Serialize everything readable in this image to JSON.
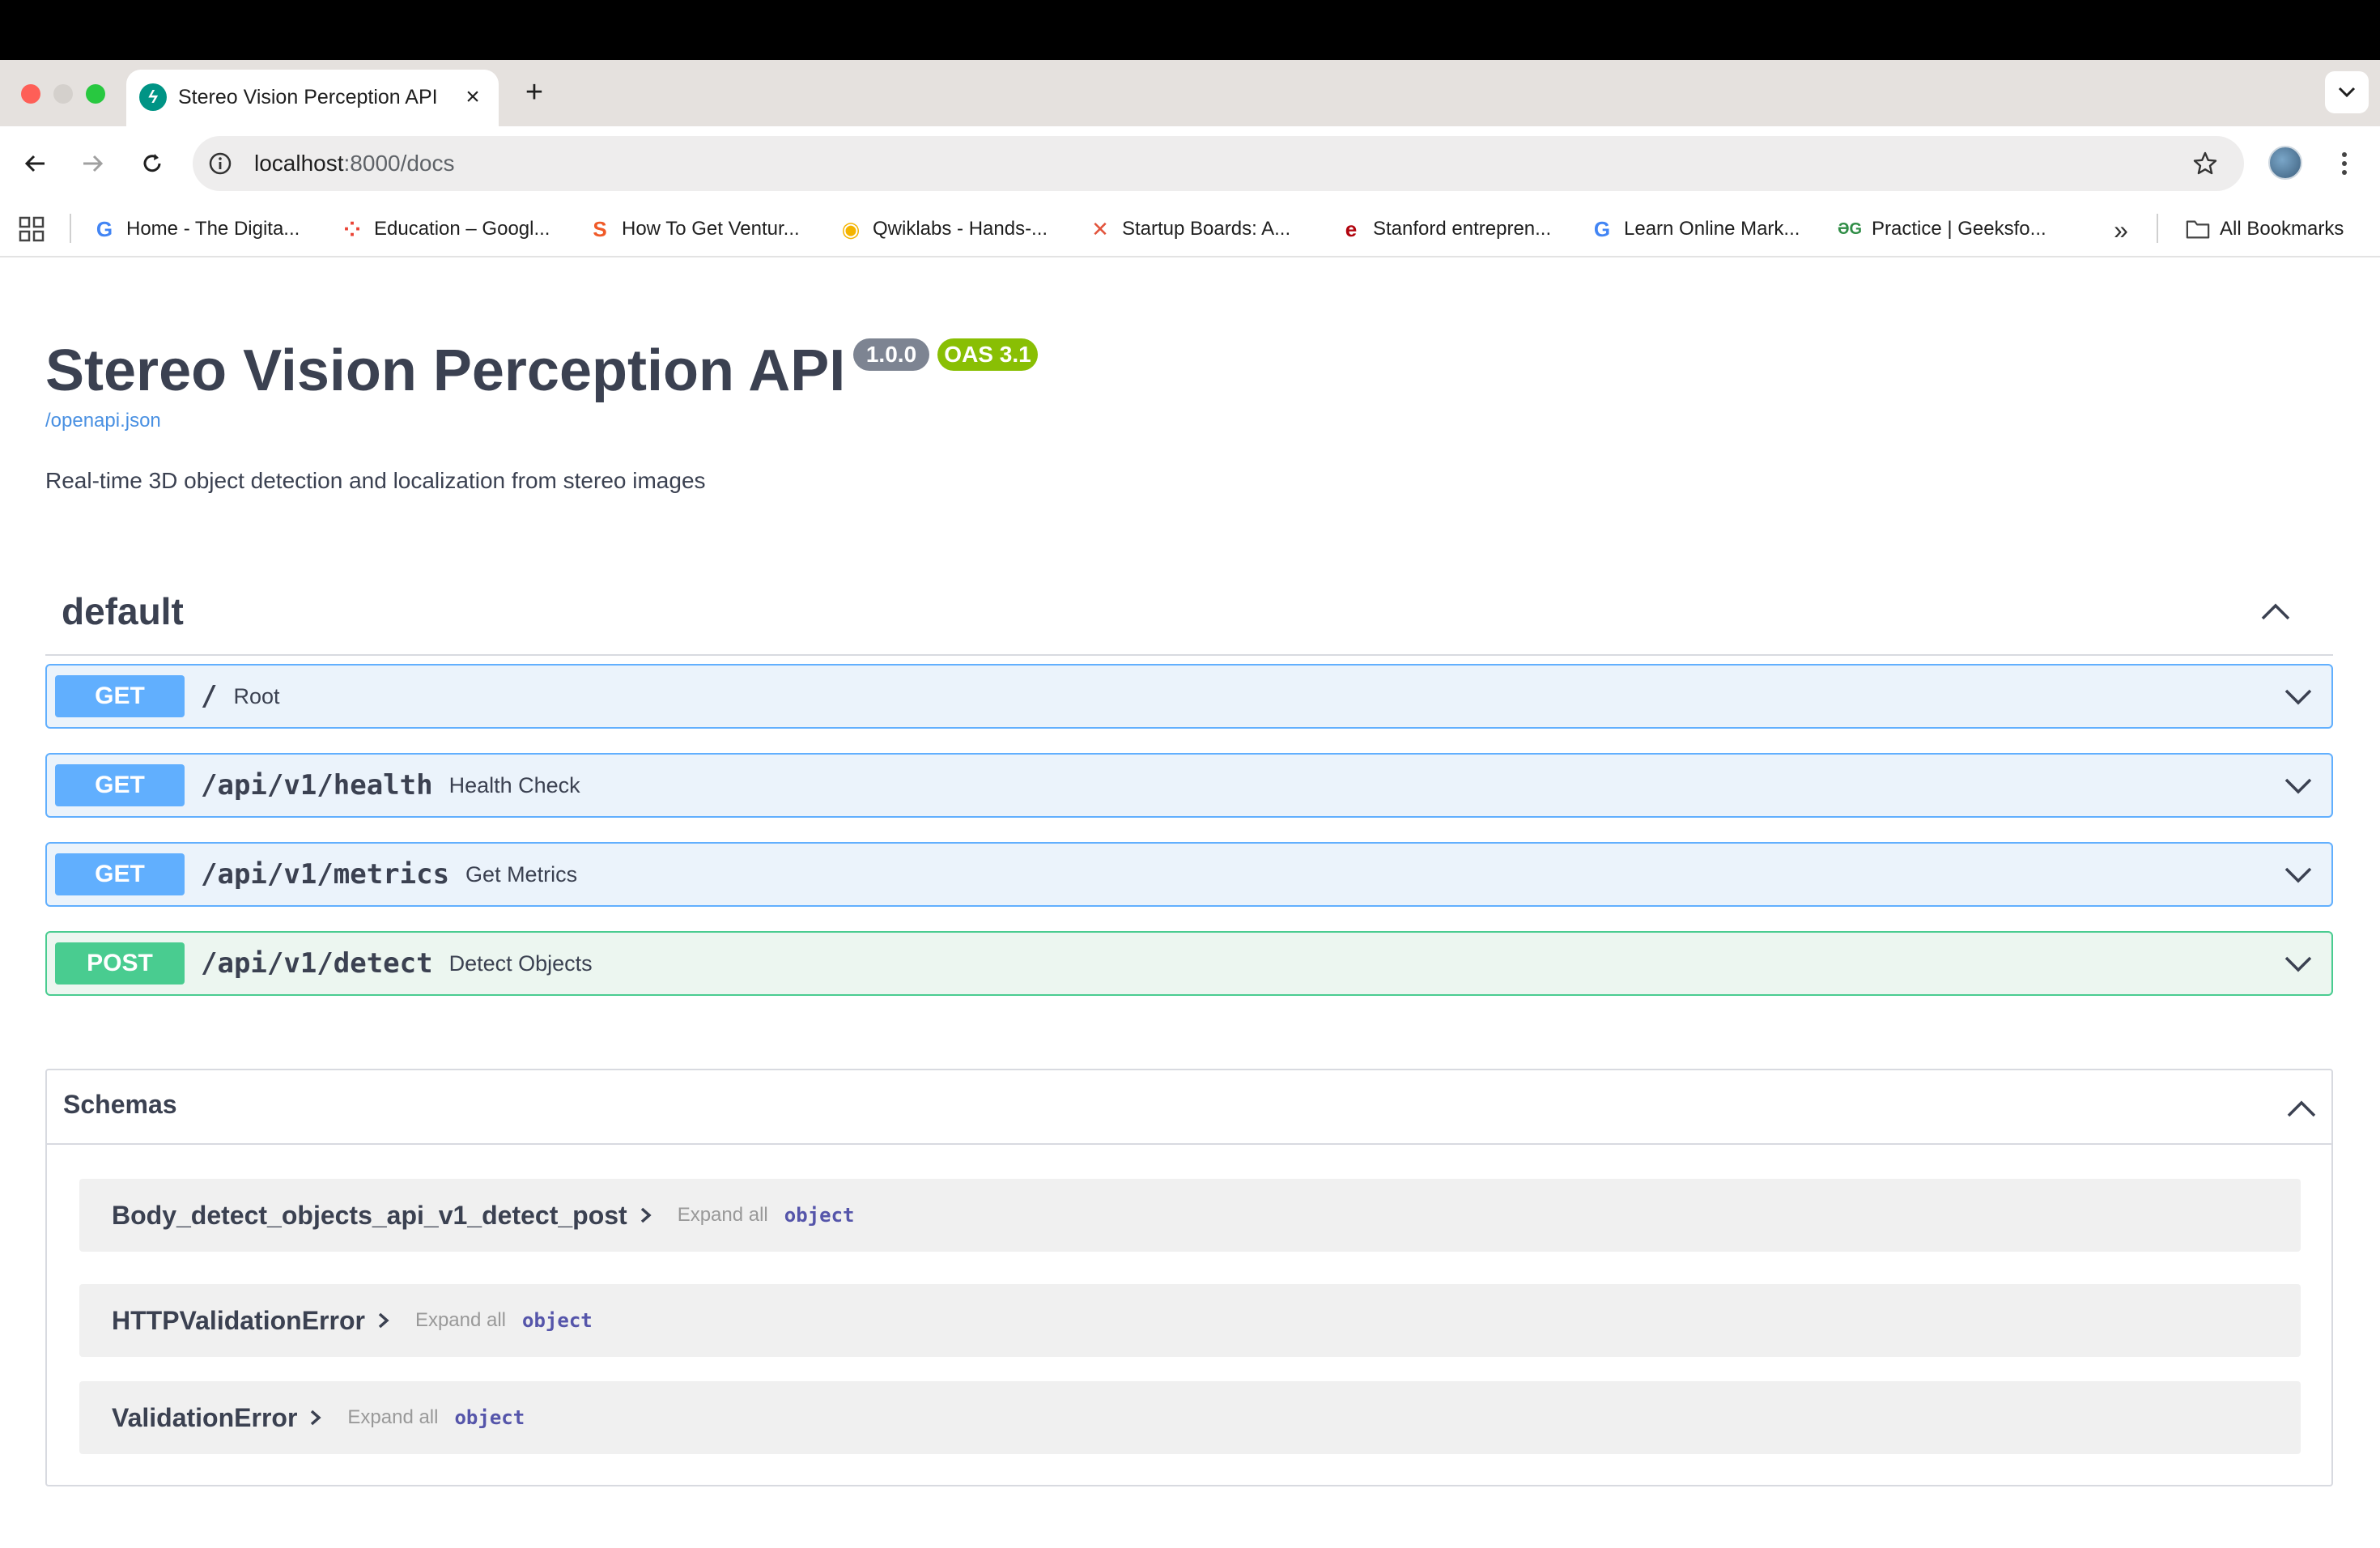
{
  "browser": {
    "tab": {
      "title": "Stereo Vision Perception API",
      "favicon": "fastapi-logo",
      "favicon_glyph": "ϟ"
    },
    "new_tab_label": "+",
    "url_host": "localhost",
    "url_path": ":8000/docs",
    "bookmarks": [
      {
        "label": "Home - The Digita...",
        "icon": "google-g-icon",
        "glyph": "G",
        "color": "#4285f4"
      },
      {
        "label": "Education – Googl...",
        "icon": "google-dots-icon",
        "glyph": "⁘",
        "color": "#ea4335"
      },
      {
        "label": "How To Get Ventur...",
        "icon": "s-logo-icon",
        "glyph": "S",
        "color": "#f05a28"
      },
      {
        "label": "Qwiklabs - Hands-...",
        "icon": "qwiklabs-icon",
        "glyph": "◉",
        "color": "#f4b400"
      },
      {
        "label": "Startup Boards: A...",
        "icon": "startup-boards-icon",
        "glyph": "✕",
        "color": "#e2543c"
      },
      {
        "label": "Stanford entrepren...",
        "icon": "stanford-e-icon",
        "glyph": "e",
        "color": "#b1040e"
      },
      {
        "label": "Learn Online Mark...",
        "icon": "google-g-icon",
        "glyph": "G",
        "color": "#4285f4"
      },
      {
        "label": "Practice | Geeksfo...",
        "icon": "geeksforgeeks-icon",
        "glyph": "ƏG",
        "color": "#2f8d46"
      }
    ],
    "more_bookmarks": "»",
    "all_bookmarks_label": "All Bookmarks"
  },
  "page": {
    "title": "Stereo Vision Perception API",
    "version": "1.0.0",
    "oas": "OAS 3.1",
    "spec_link": "/openapi.json",
    "description": "Real-time 3D object detection and localization from stereo images",
    "section": {
      "name": "default",
      "operations": [
        {
          "method": "GET",
          "path": "/",
          "summary": "Root"
        },
        {
          "method": "GET",
          "path": "/api/v1/health",
          "summary": "Health Check"
        },
        {
          "method": "GET",
          "path": "/api/v1/metrics",
          "summary": "Get Metrics"
        },
        {
          "method": "POST",
          "path": "/api/v1/detect",
          "summary": "Detect Objects"
        }
      ]
    },
    "schemas": {
      "title": "Schemas",
      "models": [
        {
          "name": "Body_detect_objects_api_v1_detect_post",
          "expand": "Expand all",
          "type": "object"
        },
        {
          "name": "HTTPValidationError",
          "expand": "Expand all",
          "type": "object"
        },
        {
          "name": "ValidationError",
          "expand": "Expand all",
          "type": "object"
        }
      ]
    },
    "colors": {
      "get": "#61affe",
      "post": "#49cc90",
      "link": "#4990e2",
      "version_badge": "#7d8492",
      "oas_badge": "#89bf04"
    }
  }
}
